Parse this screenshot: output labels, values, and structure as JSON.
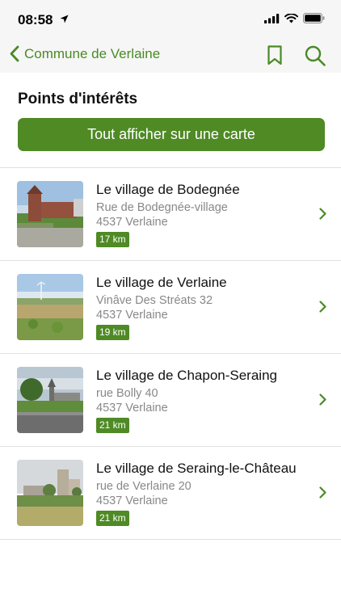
{
  "status_bar": {
    "time": "08:58",
    "icons": [
      "location-arrow-icon",
      "signal-icon",
      "wifi-icon",
      "battery-icon"
    ]
  },
  "nav": {
    "back_label": "Commune de Verlaine",
    "icons": [
      "chevron-left-icon",
      "bookmark-icon",
      "search-icon"
    ]
  },
  "section_title": "Points d'intérêts",
  "map_button_label": "Tout afficher sur une carte",
  "places": [
    {
      "title": "Le village de Bodegnée",
      "street": "Rue de Bodegnée-village",
      "city": "4537 Verlaine",
      "distance": "17 km"
    },
    {
      "title": "Le village de Verlaine",
      "street": "Vinâve Des Stréats 32",
      "city": "4537 Verlaine",
      "distance": "19 km"
    },
    {
      "title": "Le village de Chapon-Seraing",
      "street": "rue Bolly 40",
      "city": "4537 Verlaine",
      "distance": "21 km"
    },
    {
      "title": "Le village de Seraing-le-Château",
      "street": "rue de Verlaine 20",
      "city": "4537 Verlaine",
      "distance": "21 km"
    }
  ],
  "colors": {
    "accent": "#4f8a25",
    "nav_tint": "#4a8a25"
  }
}
